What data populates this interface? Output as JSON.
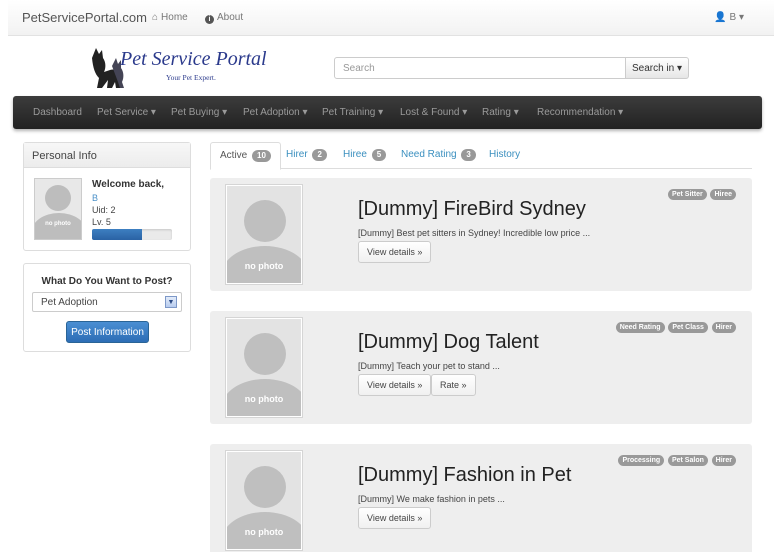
{
  "topbar": {
    "brand": "PetServicePortal.com",
    "home": "Home",
    "about": "About",
    "user": "B"
  },
  "logo": {
    "title": "Pet Service Portal",
    "subtitle": "Your Pet Expert."
  },
  "search": {
    "placeholder": "Search",
    "button": "Search in"
  },
  "menu": [
    {
      "label": "Dashboard",
      "dropdown": ""
    },
    {
      "label": "Pet Service",
      "dropdown": "▾"
    },
    {
      "label": "Pet Buying",
      "dropdown": "▾"
    },
    {
      "label": "Pet Adoption",
      "dropdown": "▾"
    },
    {
      "label": "Pet Training",
      "dropdown": "▾"
    },
    {
      "label": "Lost & Found",
      "dropdown": "▾"
    },
    {
      "label": "Rating",
      "dropdown": "▾"
    },
    {
      "label": "Recommendation",
      "dropdown": "▾"
    }
  ],
  "personal": {
    "heading": "Personal Info",
    "welcome": "Welcome back,",
    "name": "B",
    "uid": "Uid: 2",
    "level": "Lv. 5",
    "level_progress": 0.62,
    "no_photo": "no photo"
  },
  "post": {
    "title": "What Do You Want to Post?",
    "selected": "Pet Adoption",
    "button": "Post Information"
  },
  "tabs": [
    {
      "label": "Active",
      "count": "10"
    },
    {
      "label": "Hirer",
      "count": "2"
    },
    {
      "label": "Hiree",
      "count": "5"
    },
    {
      "label": "Need Rating",
      "count": "3"
    },
    {
      "label": "History",
      "count": ""
    }
  ],
  "cards": [
    {
      "title": "[Dummy] FireBird Sydney",
      "desc": "[Dummy] Best pet sitters in Sydney! Incredible low price ...",
      "no_photo": "no photo",
      "view": "View details »",
      "tags": [
        "Pet Sitter",
        "Hiree"
      ]
    },
    {
      "title": "[Dummy] Dog Talent",
      "desc": "[Dummy] Teach your pet to stand ...",
      "no_photo": "no photo",
      "view": "View details »",
      "rate": "Rate »",
      "tags": [
        "Need Rating",
        "Pet Class",
        "Hirer"
      ]
    },
    {
      "title": "[Dummy] Fashion in Pet",
      "desc": "[Dummy] We make fashion in pets ...",
      "no_photo": "no photo",
      "view": "View details »",
      "tags": [
        "Processing",
        "Pet Salon",
        "Hirer"
      ]
    }
  ]
}
